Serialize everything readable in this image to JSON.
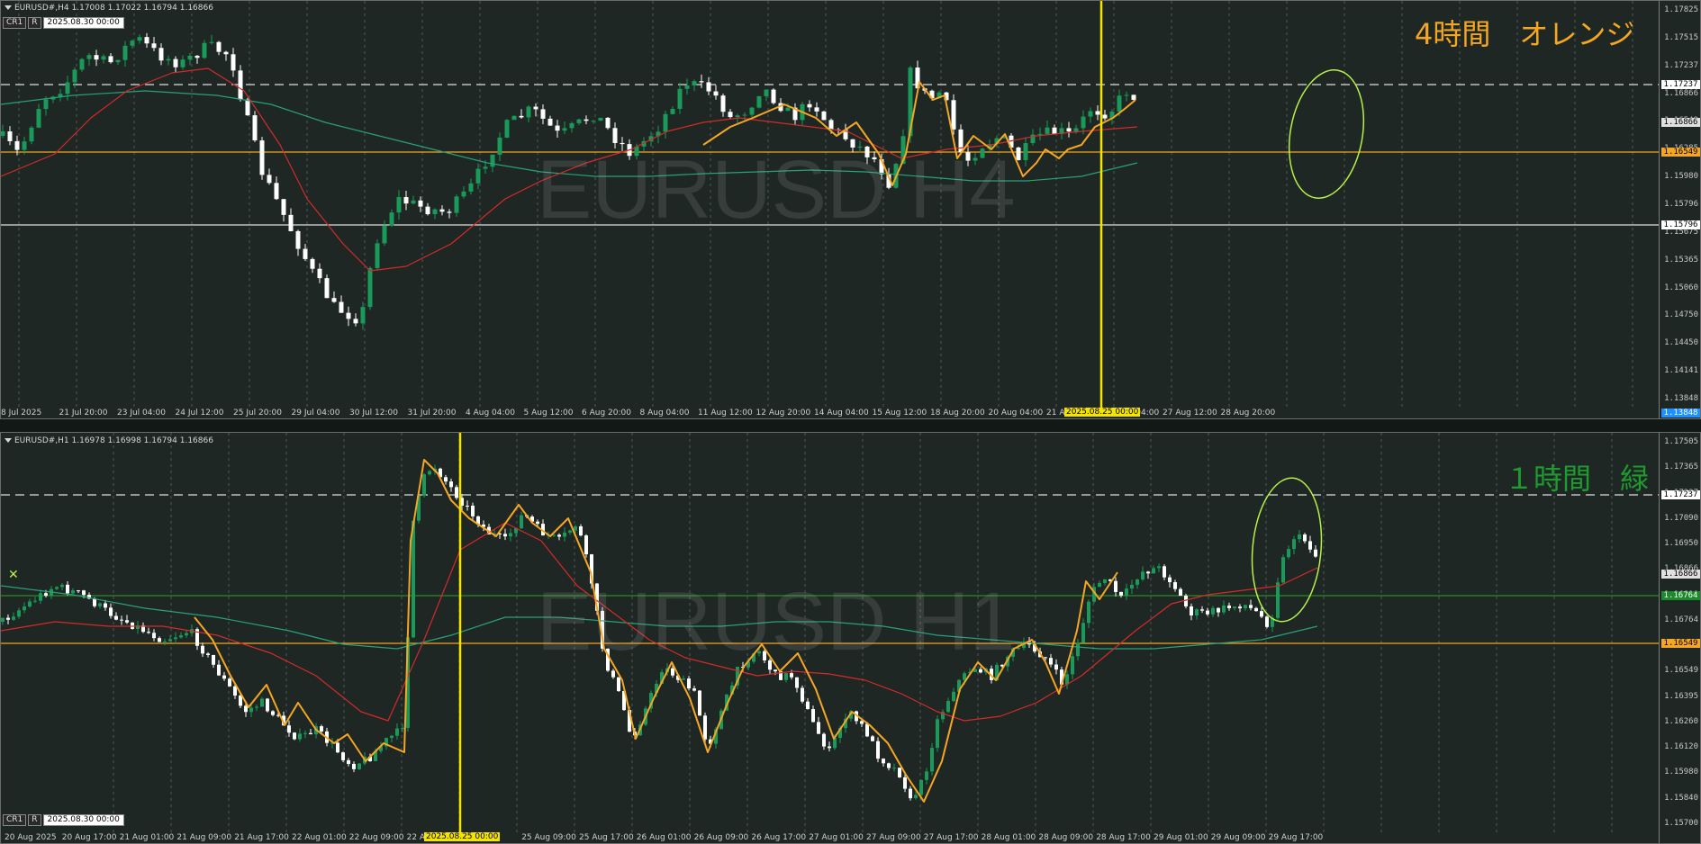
{
  "colors": {
    "bg": "#1e2723",
    "bull": "#1a9a5a",
    "bear": "#ffffff",
    "ma_fast": "#d42a2a",
    "ma_slow": "#2aa07a",
    "zigzag": "#f5a623",
    "hline_orange": "#f5a623",
    "hline_white": "#dddddd",
    "hline_green": "#2a8a2a",
    "vline": "#f5e400",
    "circle": "#b8f04a",
    "annot_top": "#f5a623",
    "annot_bottom": "#1f9a2f"
  },
  "top": {
    "info": "EURUSD#,H4  1.17008 1.17022 1.16794 1.16866",
    "cr": "CR1",
    "r": "R",
    "datetime": "2025.08.30 00:00",
    "watermark": "EURUSD H4",
    "annotation": "4時間　オレンジ",
    "price_ticks": [
      "1.17825",
      "1.17515",
      "1.17237",
      "1.16866",
      "1.16549",
      "1.16285",
      "1.15980",
      "1.15796",
      "1.15675",
      "1.15365",
      "1.15060",
      "1.14750",
      "1.14450",
      "1.14141",
      "1.13848"
    ],
    "tags": [
      {
        "text": "1.17237",
        "kind": "white"
      },
      {
        "text": "1.16866",
        "kind": "current"
      },
      {
        "text": "1.16549",
        "kind": "orange"
      },
      {
        "text": "1.15796",
        "kind": "white"
      },
      {
        "text": "1.13848",
        "kind": "blue"
      }
    ],
    "time_labels": [
      "8 Jul 2025",
      "21 Jul 20:00",
      "23 Jul 04:00",
      "24 Jul 12:00",
      "25 Jul 20:00",
      "29 Jul 04:00",
      "30 Jul 12:00",
      "31 Jul 20:00",
      "4 Aug 04:00",
      "5 Aug 12:00",
      "6 Aug 20:00",
      "8 Aug 04:00",
      "11 Aug 12:00",
      "12 Aug 20:00",
      "14 Aug 04:00",
      "15 Aug 12:00",
      "18 Aug 20:00",
      "20 Aug 04:00",
      "21 Aug",
      "26 Aug 04:00",
      "27 Aug 12:00",
      "28 Aug 20:00"
    ],
    "time_highlight": "2025.08.25 00:00"
  },
  "bottom": {
    "info": "EURUSD#,H1  1.16978 1.16998 1.16794 1.16866",
    "cr": "CR1",
    "r": "R",
    "datetime": "2025.08.30 00:00",
    "watermark": "EURUSD H1",
    "annotation": "１時間　緑",
    "price_ticks": [
      "1.17505",
      "1.17365",
      "1.17237",
      "1.17090",
      "1.16950",
      "1.16866",
      "1.16810",
      "1.16764",
      "1.16675",
      "1.16549",
      "1.16395",
      "1.16260",
      "1.16120",
      "1.15980",
      "1.15840",
      "1.15700"
    ],
    "tags": [
      {
        "text": "1.17237",
        "kind": "white"
      },
      {
        "text": "1.16866",
        "kind": "current"
      },
      {
        "text": "1.16764",
        "kind": "green"
      },
      {
        "text": "1.16549",
        "kind": "orange"
      }
    ],
    "time_labels": [
      "20 Aug 2025",
      "20 Aug 17:00",
      "21 Aug 01:00",
      "21 Aug 09:00",
      "21 Aug 17:00",
      "22 Aug 01:00",
      "22 Aug 09:00",
      "22 A",
      "01:00",
      "25 Aug 09:00",
      "25 Aug 17:00",
      "26 Aug 01:00",
      "26 Aug 09:00",
      "26 Aug 17:00",
      "27 Aug 01:00",
      "27 Aug 09:00",
      "27 Aug 17:00",
      "28 Aug 01:00",
      "28 Aug 09:00",
      "28 Aug 17:00",
      "29 Aug 01:00",
      "29 Aug 09:00",
      "29 Aug 17:00"
    ],
    "time_highlight": "2025.08.25 00:00"
  }
}
